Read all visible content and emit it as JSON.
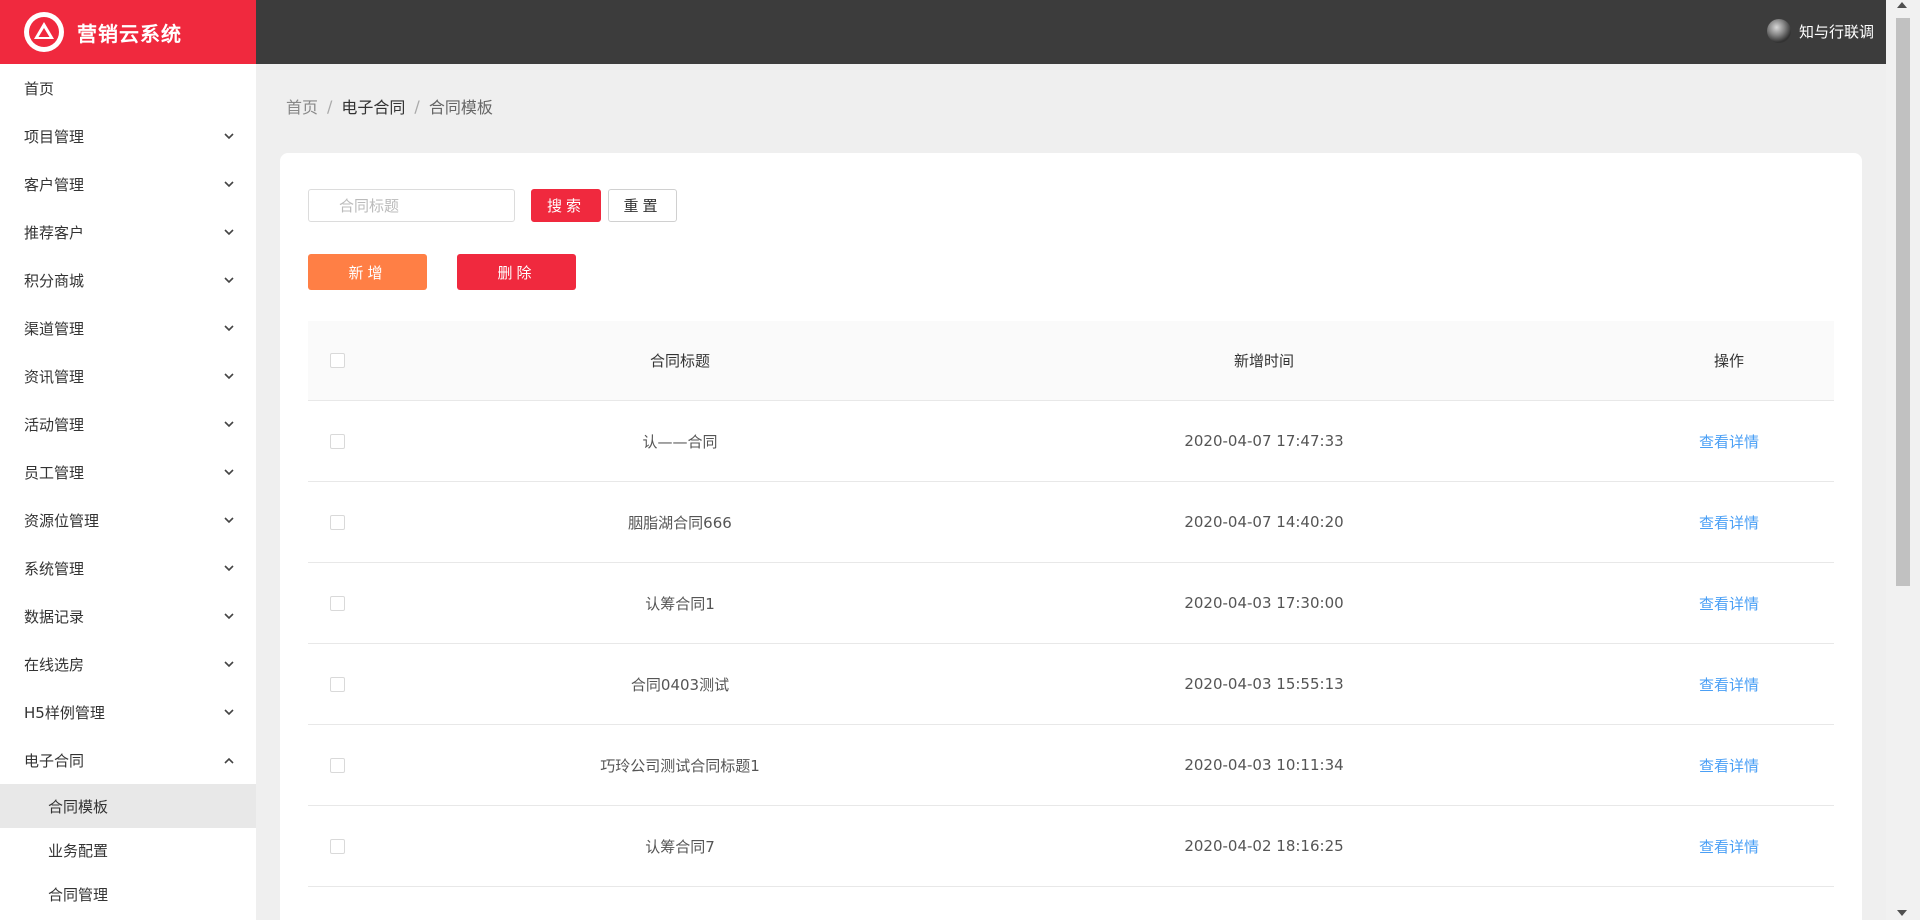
{
  "app": {
    "title": "营销云系统"
  },
  "colors": {
    "brand": "#f0293e",
    "header": "#3c3c3c",
    "add_button": "#ff7f45",
    "link": "#4a9ff5"
  },
  "user": {
    "name": "知与行联调"
  },
  "sidebar": {
    "items": [
      {
        "label": "首页",
        "expandable": false
      },
      {
        "label": "项目管理",
        "expandable": true
      },
      {
        "label": "客户管理",
        "expandable": true
      },
      {
        "label": "推荐客户",
        "expandable": true
      },
      {
        "label": "积分商城",
        "expandable": true
      },
      {
        "label": "渠道管理",
        "expandable": true
      },
      {
        "label": "资讯管理",
        "expandable": true
      },
      {
        "label": "活动管理",
        "expandable": true
      },
      {
        "label": "员工管理",
        "expandable": true
      },
      {
        "label": "资源位管理",
        "expandable": true
      },
      {
        "label": "系统管理",
        "expandable": true
      },
      {
        "label": "数据记录",
        "expandable": true
      },
      {
        "label": "在线选房",
        "expandable": true
      },
      {
        "label": "H5样例管理",
        "expandable": true
      },
      {
        "label": "电子合同",
        "expandable": true,
        "expanded": true
      }
    ],
    "subitems": [
      {
        "label": "合同模板",
        "active": true
      },
      {
        "label": "业务配置",
        "active": false
      },
      {
        "label": "合同管理",
        "active": false
      }
    ]
  },
  "breadcrumb": {
    "home": "首页",
    "section": "电子合同",
    "current": "合同模板",
    "sep": "/"
  },
  "search": {
    "placeholder": "合同标题",
    "value": "",
    "search_label": "搜索",
    "reset_label": "重置"
  },
  "actions": {
    "add_label": "新增",
    "delete_label": "删除"
  },
  "table": {
    "headers": {
      "title": "合同标题",
      "time": "新增时间",
      "op": "操作"
    },
    "rows": [
      {
        "title": "认——合同",
        "time": "2020-04-07 17:47:33",
        "op": "查看详情"
      },
      {
        "title": "胭脂湖合同666",
        "time": "2020-04-07 14:40:20",
        "op": "查看详情"
      },
      {
        "title": "认筹合同1",
        "time": "2020-04-03 17:30:00",
        "op": "查看详情"
      },
      {
        "title": "合同0403测试",
        "time": "2020-04-03 15:55:13",
        "op": "查看详情"
      },
      {
        "title": "巧玲公司测试合同标题1",
        "time": "2020-04-03 10:11:34",
        "op": "查看详情"
      },
      {
        "title": "认筹合同7",
        "time": "2020-04-02 18:16:25",
        "op": "查看详情"
      }
    ]
  }
}
